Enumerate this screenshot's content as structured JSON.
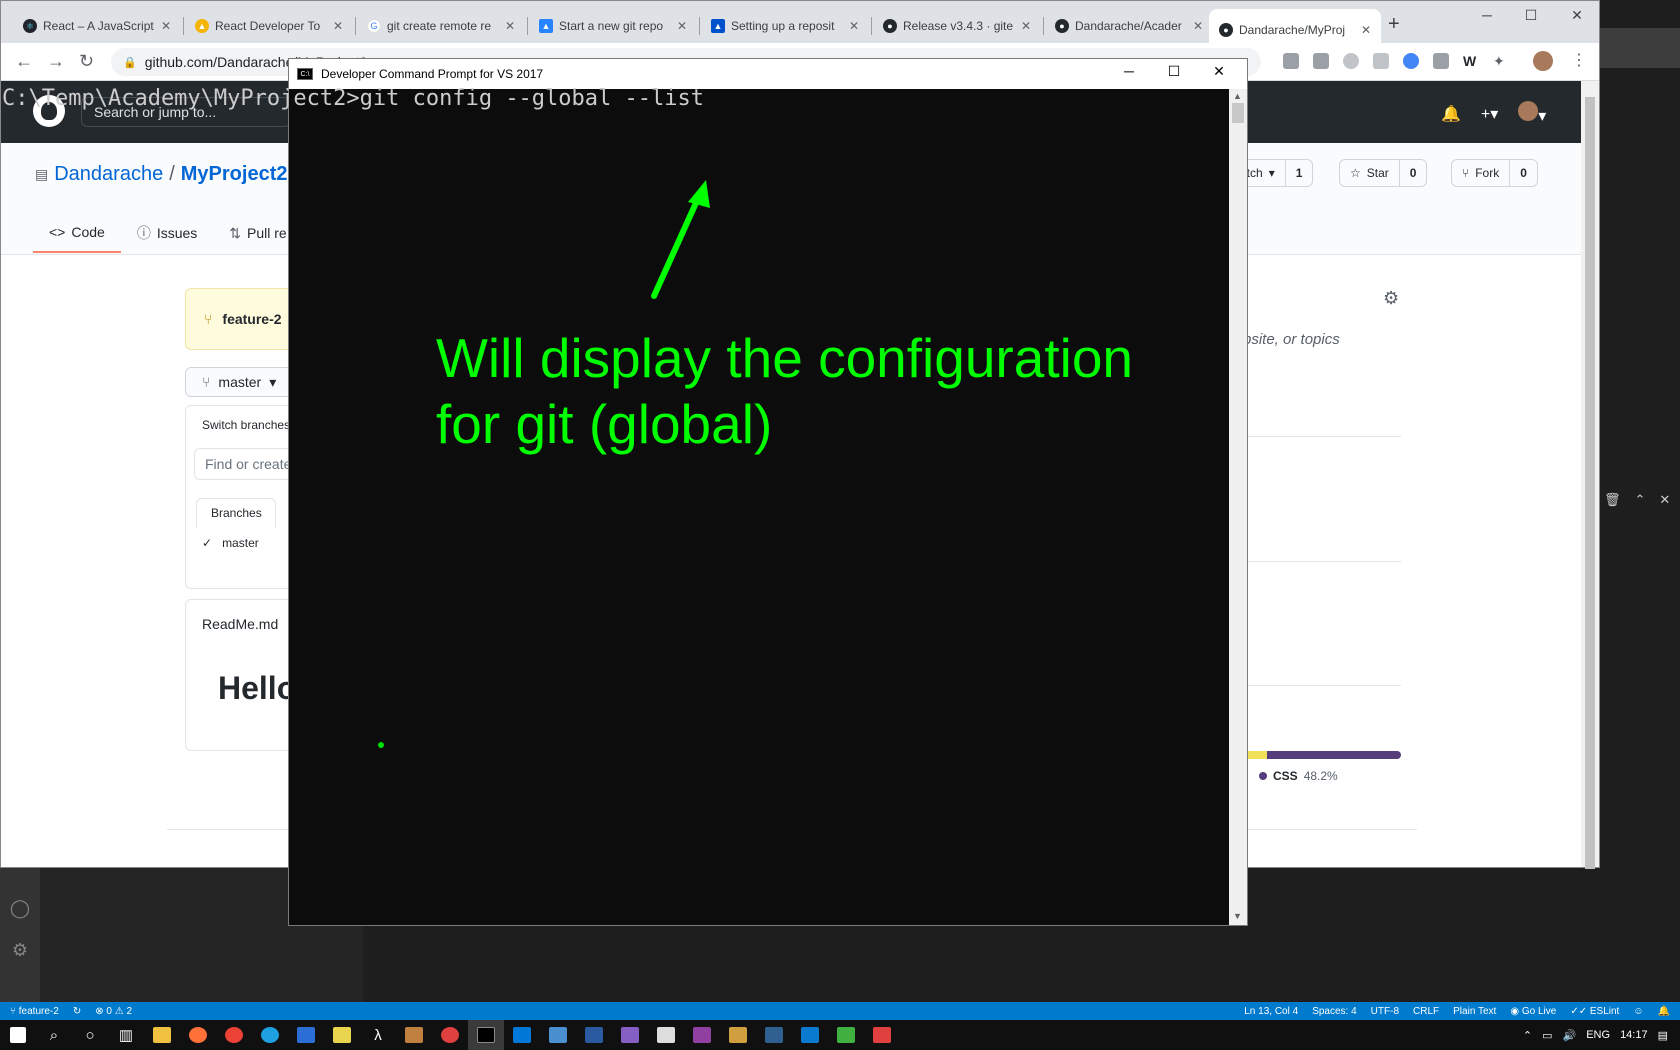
{
  "chrome": {
    "tabs": [
      {
        "label": "React – A JavaScript",
        "fav_color": "#20232a"
      },
      {
        "label": "React Developer To",
        "fav_color": "#f4b400"
      },
      {
        "label": "git create remote re",
        "fav_color": "#4285f4"
      },
      {
        "label": "Start a new git repo",
        "fav_color": "#2684ff"
      },
      {
        "label": "Setting up a reposit",
        "fav_color": "#0052cc"
      },
      {
        "label": "Release v3.4.3 · gite",
        "fav_color": "#24292e"
      },
      {
        "label": "Dandarache/Acader",
        "fav_color": "#24292e"
      },
      {
        "label": "Dandarache/MyProj",
        "fav_color": "#24292e"
      }
    ],
    "url": "github.com/Dandarache/MyProject2"
  },
  "github": {
    "search_placeholder": "Search or jump to...",
    "owner": "Dandarache",
    "separator": "/",
    "repo": "MyProject2",
    "nav": [
      "Code",
      "Issues",
      "Pull re"
    ],
    "watch_label": "atch",
    "watch_count": "1",
    "star_label": "Star",
    "star_count": "0",
    "fork_label": "Fork",
    "fork_count": "0",
    "flash_branch": "feature-2",
    "branch": "master",
    "branch_menu_title": "Switch branches",
    "branch_filter_placeholder": "Find or create",
    "branches_tab": "Branches",
    "branch_item": "master",
    "readme_title": "ReadMe.md",
    "readme_heading": "Hello",
    "about_text": "bsite, or topics",
    "about_link": "e",
    "lang_css": "CSS",
    "lang_css_pct": "48.2%",
    "lang_css_color": "#563d7c",
    "lang_js_color": "#f1e05a"
  },
  "cmd": {
    "title": "Developer Command Prompt for VS 2017",
    "line": "C:\\Temp\\Academy\\MyProject2>git config --global --list",
    "annotation_line1": "Will display the configuration",
    "annotation_line2": "for git (global)",
    "annotation_color": "#00ff00"
  },
  "vscode_status": {
    "branch": "feature-2",
    "errors": "0",
    "warnings": "2",
    "position": "Ln 13, Col 4",
    "spaces": "Spaces: 4",
    "encoding": "UTF-8",
    "eol": "CRLF",
    "language": "Plain Text",
    "golive": "Go Live",
    "eslint": "ESLint"
  },
  "taskbar": {
    "lang": "ENG",
    "time": "14:17"
  }
}
